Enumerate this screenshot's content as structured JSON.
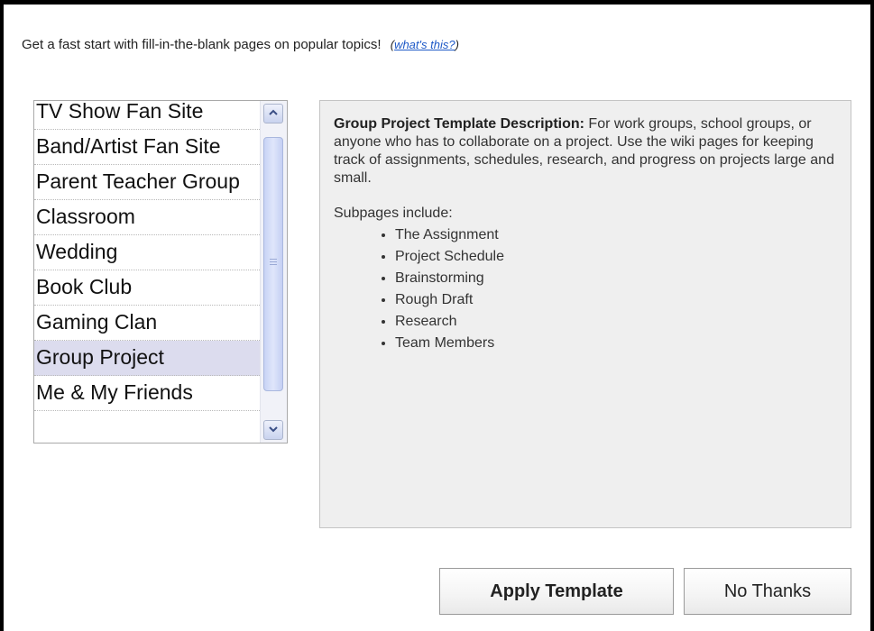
{
  "intro": {
    "text": "Get a fast start with fill-in-the-blank pages on popular topics!",
    "paren_open": "(",
    "link_text": "what's this?",
    "paren_close": ")"
  },
  "template_list": {
    "items": [
      {
        "label": "TV Show Fan Site"
      },
      {
        "label": "Band/Artist Fan Site"
      },
      {
        "label": "Parent Teacher Group"
      },
      {
        "label": "Classroom"
      },
      {
        "label": "Wedding"
      },
      {
        "label": "Book Club"
      },
      {
        "label": "Gaming Clan"
      },
      {
        "label": "Group Project"
      },
      {
        "label": "Me & My Friends"
      }
    ],
    "selected": "Group Project"
  },
  "description": {
    "heading": "Group Project Template Description:",
    "body": " For work groups, school groups, or anyone who has to collaborate on a project. Use the wiki pages for keeping track of assignments, schedules, research, and progress on projects large and small.",
    "subpages_label": "Subpages include:",
    "subpages": [
      "The Assignment",
      "Project Schedule",
      "Brainstorming",
      "Rough Draft",
      "Research",
      "Team Members"
    ]
  },
  "buttons": {
    "apply": "Apply Template",
    "no_thanks": "No Thanks"
  },
  "icons": {
    "scroll_up": "chevron-up-icon",
    "scroll_down": "chevron-down-icon"
  },
  "colors": {
    "link": "#1e59c7",
    "selected_row": "#dcdcee",
    "panel_bg": "#efefef"
  }
}
